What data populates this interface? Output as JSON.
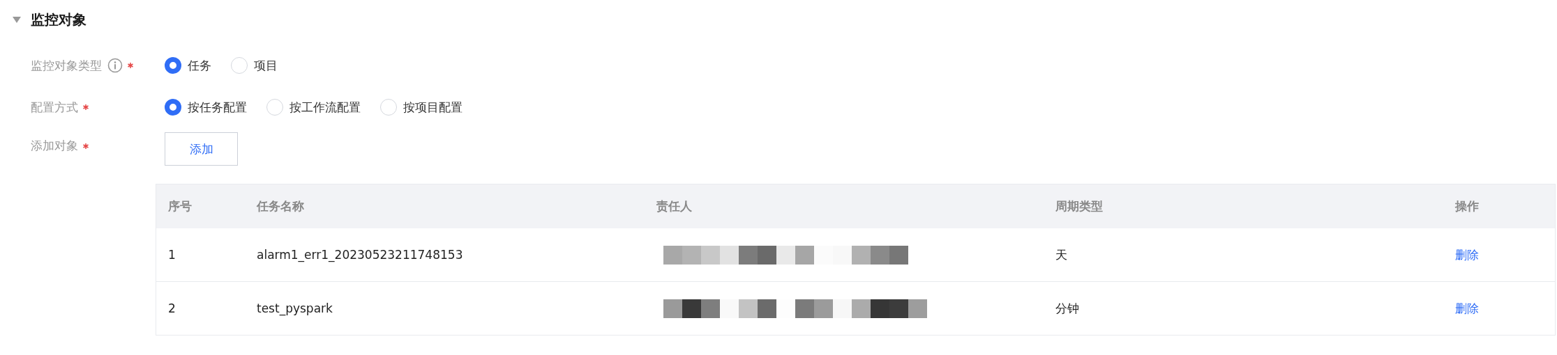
{
  "section": {
    "title": "监控对象",
    "expanded": true
  },
  "form": [
    {
      "kind": "radio",
      "label": "监控对象类型",
      "info": true,
      "required": true,
      "options": [
        {
          "label": "任务",
          "selected": true
        },
        {
          "label": "项目",
          "selected": false
        }
      ]
    },
    {
      "kind": "radio",
      "label": "配置方式",
      "info": false,
      "required": true,
      "options": [
        {
          "label": "按任务配置",
          "selected": true
        },
        {
          "label": "按工作流配置",
          "selected": false
        },
        {
          "label": "按项目配置",
          "selected": false
        }
      ]
    },
    {
      "kind": "button",
      "label": "添加对象",
      "info": false,
      "required": true,
      "button": "添加"
    }
  ],
  "table": {
    "columns": [
      "序号",
      "任务名称",
      "责任人",
      "周期类型",
      "操作"
    ],
    "rows": [
      {
        "index": "1",
        "name": "alarm1_err1_20230523211748153",
        "period": "天",
        "action": "删除"
      },
      {
        "index": "2",
        "name": "test_pyspark",
        "period": "分钟",
        "action": "删除"
      }
    ]
  }
}
